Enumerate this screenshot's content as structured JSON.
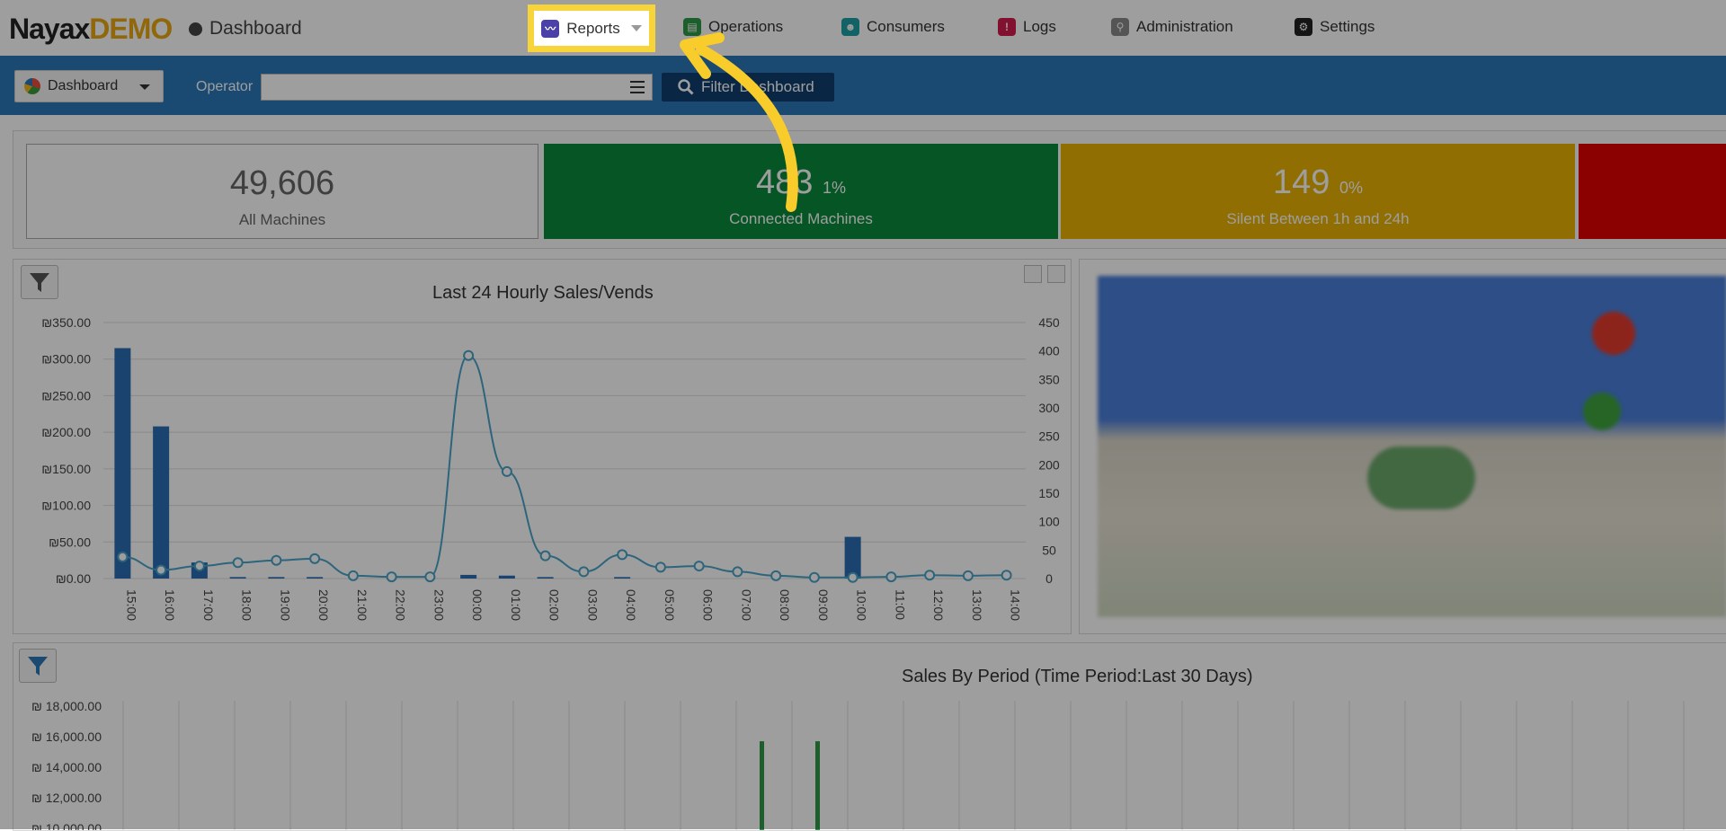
{
  "header": {
    "logo_brand": "Nayax",
    "logo_demo": "DEMO",
    "page_title": "Dashboard",
    "nav": [
      {
        "label": "Reports",
        "icon": "reports-icon",
        "color": "#4b3fa8"
      },
      {
        "label": "Operations",
        "icon": "operations-icon",
        "color": "#2f9a48"
      },
      {
        "label": "Consumers",
        "icon": "consumers-icon",
        "color": "#1f9fa5"
      },
      {
        "label": "Logs",
        "icon": "logs-icon",
        "color": "#d21c4f"
      },
      {
        "label": "Administration",
        "icon": "administration-icon",
        "color": "#8a8a8a"
      },
      {
        "label": "Settings",
        "icon": "settings-icon",
        "color": "#222222"
      }
    ]
  },
  "filterbar": {
    "dashboard_select": "Dashboard",
    "operator_label": "Operator",
    "operator_value": "",
    "filter_button": "Filter Dashboard"
  },
  "kpis": [
    {
      "value": "49,606",
      "pct": "",
      "label": "All Machines",
      "color": "#ffffff"
    },
    {
      "value": "483",
      "pct": "1%",
      "label": "Connected Machines",
      "color": "#0a8a3a"
    },
    {
      "value": "149",
      "pct": "0%",
      "label": "Silent Between 1h and 24h",
      "color": "#e8b203"
    },
    {
      "value": "",
      "pct": "",
      "label": "",
      "color": "#e10000"
    }
  ],
  "chart_data": [
    {
      "type": "bar",
      "title": "Last 24 Hourly Sales/Vends",
      "categories": [
        "15:00",
        "16:00",
        "17:00",
        "18:00",
        "19:00",
        "20:00",
        "21:00",
        "22:00",
        "23:00",
        "00:00",
        "01:00",
        "02:00",
        "03:00",
        "04:00",
        "05:00",
        "06:00",
        "07:00",
        "08:00",
        "09:00",
        "10:00",
        "11:00",
        "12:00",
        "13:00",
        "14:00"
      ],
      "y_left_ticks": [
        "₪0.00",
        "₪50.00",
        "₪100.00",
        "₪150.00",
        "₪200.00",
        "₪250.00",
        "₪300.00",
        "₪350.00"
      ],
      "y_right_ticks": [
        "0",
        "50",
        "100",
        "150",
        "200",
        "250",
        "300",
        "350",
        "400",
        "450"
      ],
      "ylim_left": [
        0,
        350
      ],
      "ylim_right": [
        0,
        450
      ],
      "series": [
        {
          "kind": "bar",
          "axis": "left",
          "color": "#2a6db3",
          "values": [
            315,
            208,
            22,
            2,
            2,
            2,
            0,
            0,
            0,
            5,
            4,
            2,
            0,
            2,
            0,
            0,
            0,
            0,
            0,
            57,
            0,
            0,
            0,
            0
          ]
        },
        {
          "kind": "line",
          "axis": "right",
          "color": "#4aa3c8",
          "values": [
            38,
            15,
            22,
            28,
            32,
            35,
            5,
            3,
            3,
            392,
            188,
            40,
            12,
            42,
            20,
            22,
            12,
            5,
            2,
            2,
            3,
            6,
            5,
            6
          ]
        }
      ]
    },
    {
      "type": "bar",
      "title": "Sales By Period (Time Period:Last 30 Days)",
      "y_ticks": [
        "₪ 18,000.00",
        "₪ 16,000.00",
        "₪ 14,000.00",
        "₪ 12,000.00",
        "₪ 10,000.00"
      ],
      "ylim": [
        10000,
        18000
      ],
      "series": [
        {
          "kind": "bar",
          "color": "#2f9a48",
          "values_visible": [
            15700,
            15700
          ]
        }
      ]
    }
  ],
  "colors": {
    "filter_bar": "#2a78b9",
    "highlight": "#f7d43a",
    "arrow": "#f7cc2b"
  }
}
